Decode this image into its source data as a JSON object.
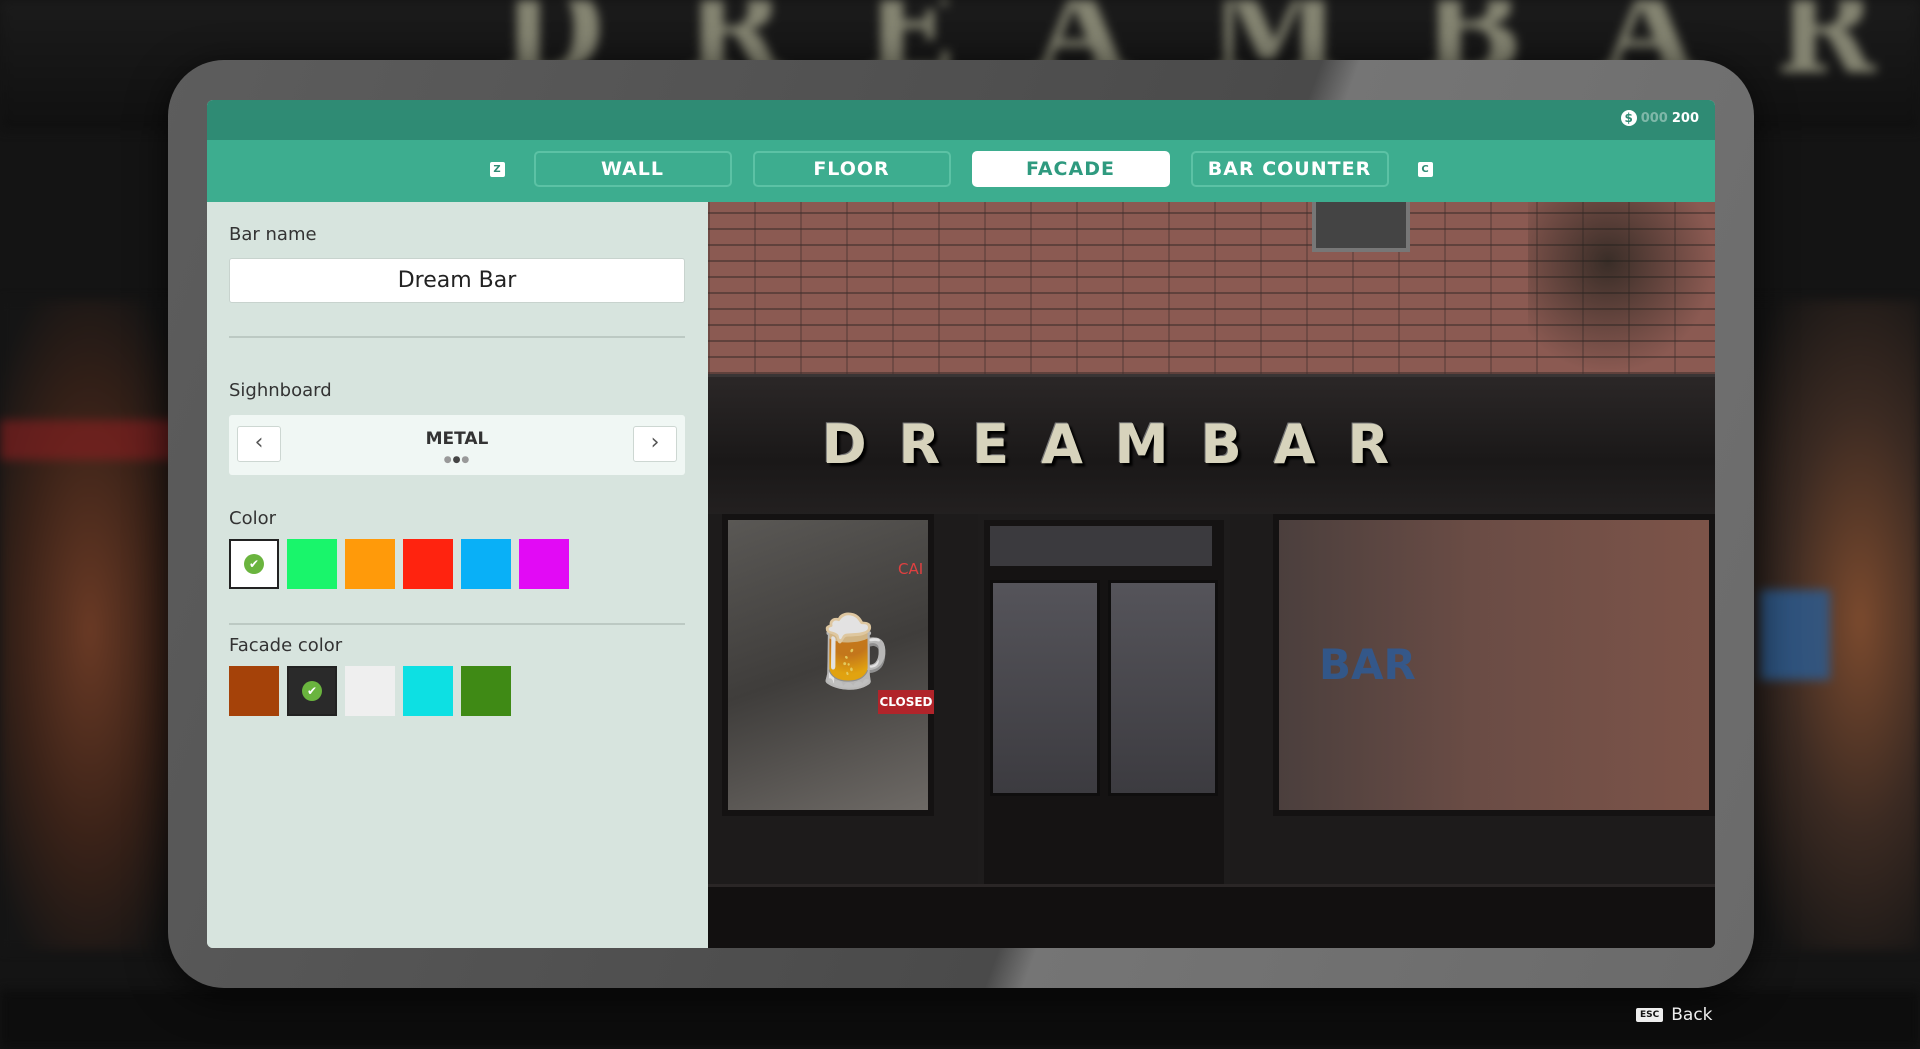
{
  "background": {
    "letters": "DREAMBAR"
  },
  "currency": {
    "icon": "dollar-icon",
    "faded_digits": "000",
    "amount": "200"
  },
  "tabs": {
    "prev_key": "Z",
    "next_key": "C",
    "items": [
      {
        "label": "WALL",
        "active": false
      },
      {
        "label": "FLOOR",
        "active": false
      },
      {
        "label": "FACADE",
        "active": true
      },
      {
        "label": "BAR COUNTER",
        "active": false
      }
    ]
  },
  "panel": {
    "bar_name_label": "Bar name",
    "bar_name_value": "Dream Bar",
    "signboard_label": "Sighnboard",
    "signboard_value": "METAL",
    "signboard_page": 2,
    "signboard_pages": 3,
    "color_label": "Color",
    "colors": [
      "#ffffff",
      "#19f56b",
      "#ff9a0a",
      "#ff230f",
      "#09b0f7",
      "#e20af5"
    ],
    "selected_color": 0,
    "facade_color_label": "Facade color",
    "facade_colors": [
      "#a54209",
      "#2a2a2a",
      "#efefef",
      "#0de0e3",
      "#3f8a15"
    ],
    "selected_facade_color": 1
  },
  "preview": {
    "sign_text": "DREAMBAR",
    "closed_sign": "CLOSED",
    "window_neon": "CAI",
    "window_text": "BAR"
  },
  "footer": {
    "key": "ESC",
    "back_label": "Back"
  }
}
